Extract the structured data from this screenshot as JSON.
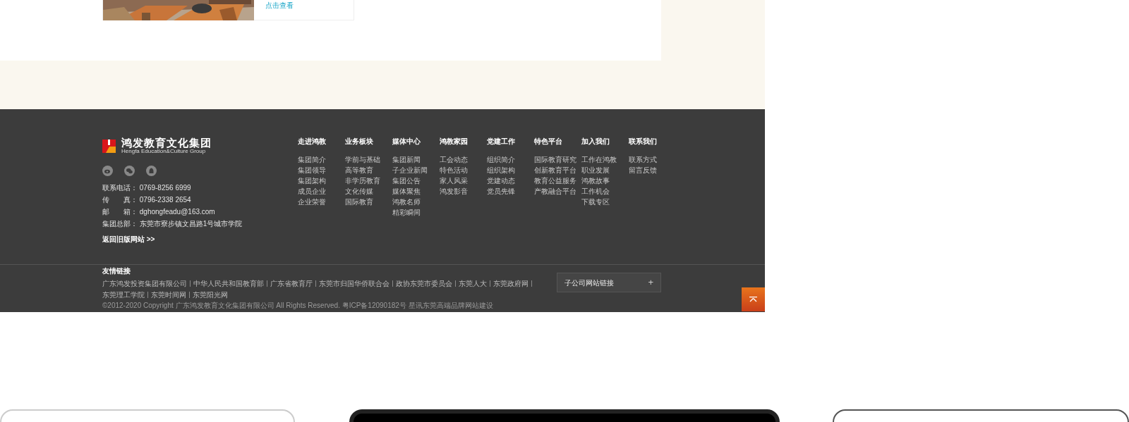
{
  "article": {
    "link": "点击查看"
  },
  "footer": {
    "logo": {
      "name": "鸿发教育文化集团",
      "subtitle": "Hengfa Education&Culture Group"
    },
    "contacts": [
      {
        "label": "联系电话：",
        "value": "0769-8256 6999"
      },
      {
        "label": "传　　真：",
        "value": "0796-2338 2654"
      },
      {
        "label": "邮　　箱：",
        "value": "dghongfeadu@163.com"
      },
      {
        "label": "集团总部：",
        "value": "东莞市寮步镇文昌路1号城市学院"
      }
    ],
    "old_site_link": "返回旧版网站 >>",
    "columns": [
      {
        "title": "走进鸿教",
        "items": [
          "集团简介",
          "集团领导",
          "集团架构",
          "成员企业",
          "企业荣誉"
        ]
      },
      {
        "title": "业务板块",
        "items": [
          "学前与基础",
          "高等教育",
          "非学历教育",
          "文化传媒",
          "国际教育"
        ]
      },
      {
        "title": "媒体中心",
        "items": [
          "集团新闻",
          "子企业新闻",
          "集团公告",
          "媒体聚焦",
          "鸿教名师",
          "精彩瞬间"
        ]
      },
      {
        "title": "鸿教家园",
        "items": [
          "工会动态",
          "特色活动",
          "家人风采",
          "鸿发影音"
        ]
      },
      {
        "title": "党建工作",
        "items": [
          "组织简介",
          "组织架构",
          "党建动态",
          "党员先锋"
        ]
      },
      {
        "title": "特色平台",
        "items": [
          "国际教育研究",
          "创新教育平台",
          "教育公益服务",
          "产教融合平台"
        ]
      },
      {
        "title": "加入我们",
        "items": [
          "工作在鸿教",
          "职业发展",
          "鸿教故事",
          "工作机会",
          "下载专区"
        ]
      },
      {
        "title": "联系我们",
        "items": [
          "联系方式",
          "留言反馈"
        ]
      }
    ],
    "friend_links_title": "友情链接",
    "friend_links": [
      "广东鸿发投资集团有限公司",
      "中华人民共和国教育部",
      "广东省教育厅",
      "东莞市归国华侨联合会",
      "政协东莞市委员会",
      "东莞人大",
      "东莞政府网",
      "东莞理工学院",
      "东莞时间网",
      "东莞阳光网"
    ],
    "copyright": "©2012-2020 Copyright  广东鸿发教育文化集团有限公司  All Rights Reserved. 粤ICP备12090182号  星讯东莞高端品牌网站建设",
    "subsidiary_select": {
      "label": "子公司网站链接",
      "icon": "+"
    }
  }
}
